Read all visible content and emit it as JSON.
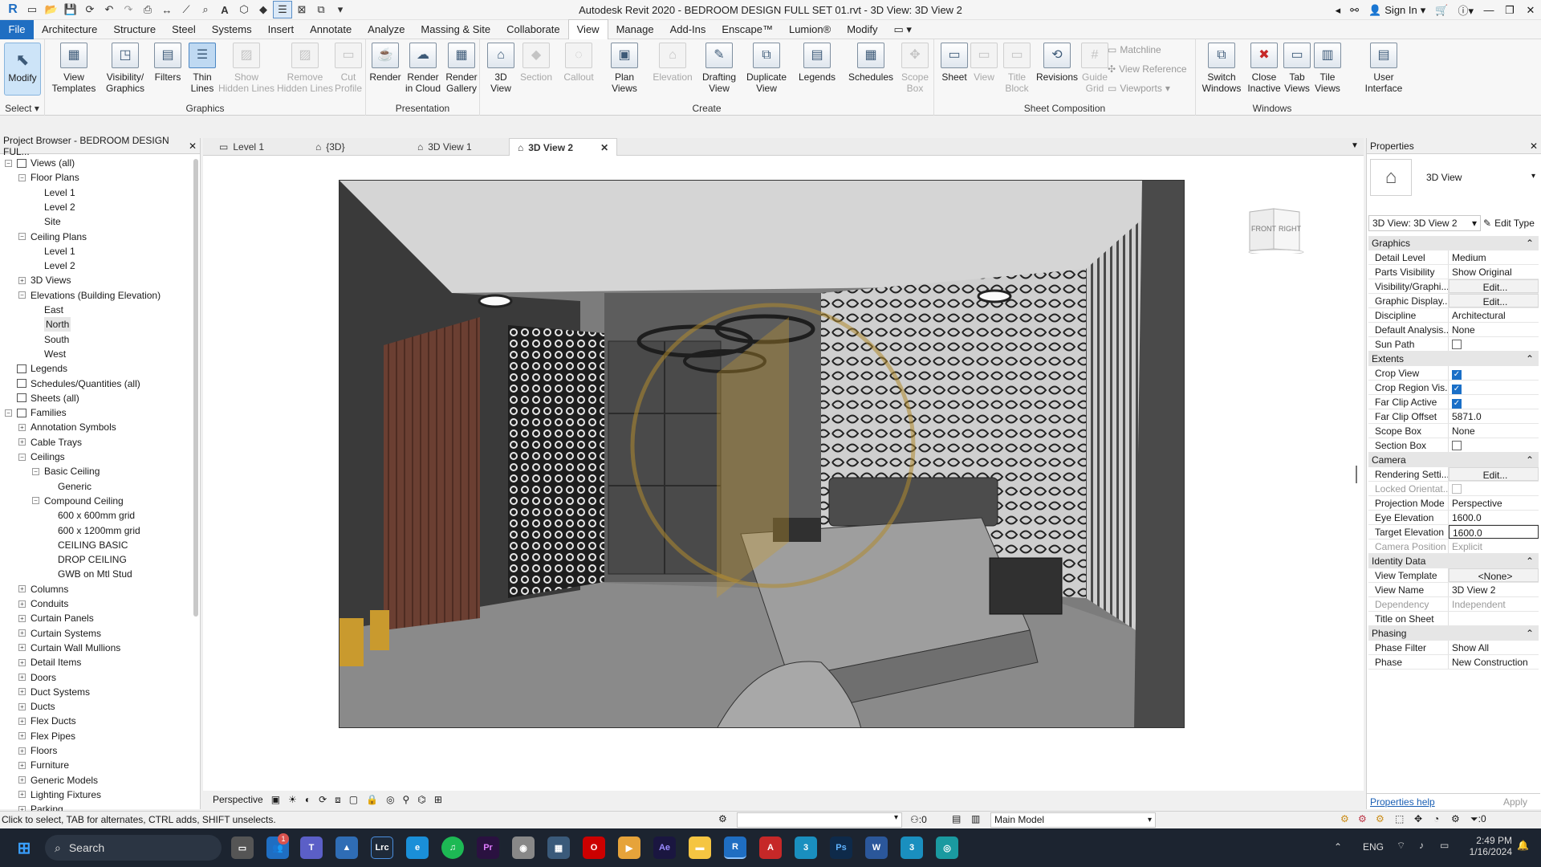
{
  "window": {
    "title": "Autodesk Revit 2020 - BEDROOM DESIGN FULL SET 01.rvt - 3D View: 3D View 2",
    "sign_in": "Sign In"
  },
  "menu": {
    "tabs": [
      "File",
      "Architecture",
      "Structure",
      "Steel",
      "Systems",
      "Insert",
      "Annotate",
      "Analyze",
      "Massing & Site",
      "Collaborate",
      "View",
      "Manage",
      "Add-Ins",
      "Enscape™",
      "Lumion®",
      "Modify"
    ],
    "active": "View"
  },
  "ribbon": {
    "select_label": "Select",
    "graphics_label": "Graphics",
    "presentation_label": "Presentation",
    "create_label": "Create",
    "sheet_comp_label": "Sheet Composition",
    "windows_label": "Windows",
    "buttons": {
      "modify": "Modify",
      "view_templates": "View\nTemplates",
      "visibility": "Visibility/\nGraphics",
      "filters": "Filters",
      "thin_lines": "Thin\nLines",
      "show_hidden": "Show\nHidden Lines",
      "remove_hidden": "Remove\nHidden Lines",
      "cut_profile": "Cut\nProfile",
      "render": "Render",
      "render_cloud": "Render\nin Cloud",
      "render_gallery": "Render\nGallery",
      "view3d": "3D\nView",
      "section": "Section",
      "callout": "Callout",
      "plan_views": "Plan\nViews",
      "elevation": "Elevation",
      "drafting_view": "Drafting\nView",
      "duplicate_view": "Duplicate\nView",
      "legends": "Legends",
      "schedules": "Schedules",
      "scope_box": "Scope\nBox",
      "sheet": "Sheet",
      "view": "View",
      "title_block": "Title\nBlock",
      "revisions": "Revisions",
      "guide_grid": "Guide\nGrid",
      "matchline": "Matchline",
      "view_reference": "View Reference",
      "viewports": "Viewports",
      "switch_windows": "Switch\nWindows",
      "close_inactive": "Close\nInactive",
      "tab_views": "Tab\nViews",
      "tile_views": "Tile\nViews",
      "user_interface": "User\nInterface"
    }
  },
  "project_browser": {
    "title": "Project Browser - BEDROOM DESIGN FUL...",
    "items": [
      {
        "label": "Views (all)",
        "level": 0,
        "tog": "−",
        "icon": "views"
      },
      {
        "label": "Floor Plans",
        "level": 1,
        "tog": "−"
      },
      {
        "label": "Level 1",
        "level": 2
      },
      {
        "label": "Level 2",
        "level": 2
      },
      {
        "label": "Site",
        "level": 2
      },
      {
        "label": "Ceiling Plans",
        "level": 1,
        "tog": "−"
      },
      {
        "label": "Level 1",
        "level": 2
      },
      {
        "label": "Level 2",
        "level": 2
      },
      {
        "label": "3D Views",
        "level": 1,
        "tog": "+"
      },
      {
        "label": "Elevations (Building Elevation)",
        "level": 1,
        "tog": "−"
      },
      {
        "label": "East",
        "level": 2
      },
      {
        "label": "North",
        "level": 2,
        "selected": true
      },
      {
        "label": "South",
        "level": 2
      },
      {
        "label": "West",
        "level": 2
      },
      {
        "label": "Legends",
        "level": 0,
        "icon": "legend"
      },
      {
        "label": "Schedules/Quantities (all)",
        "level": 0,
        "icon": "schedule"
      },
      {
        "label": "Sheets (all)",
        "level": 0,
        "icon": "sheet"
      },
      {
        "label": "Families",
        "level": 0,
        "tog": "−",
        "icon": "family"
      },
      {
        "label": "Annotation Symbols",
        "level": 1,
        "tog": "+"
      },
      {
        "label": "Cable Trays",
        "level": 1,
        "tog": "+"
      },
      {
        "label": "Ceilings",
        "level": 1,
        "tog": "−"
      },
      {
        "label": "Basic Ceiling",
        "level": 2,
        "tog": "−"
      },
      {
        "label": "Generic",
        "level": 3
      },
      {
        "label": "Compound Ceiling",
        "level": 2,
        "tog": "−"
      },
      {
        "label": "600 x 600mm grid",
        "level": 3
      },
      {
        "label": "600 x 1200mm grid",
        "level": 3
      },
      {
        "label": "CEILING BASIC",
        "level": 3
      },
      {
        "label": "DROP CEILING",
        "level": 3
      },
      {
        "label": "GWB on Mtl Stud",
        "level": 3
      },
      {
        "label": "Columns",
        "level": 1,
        "tog": "+"
      },
      {
        "label": "Conduits",
        "level": 1,
        "tog": "+"
      },
      {
        "label": "Curtain Panels",
        "level": 1,
        "tog": "+"
      },
      {
        "label": "Curtain Systems",
        "level": 1,
        "tog": "+"
      },
      {
        "label": "Curtain Wall Mullions",
        "level": 1,
        "tog": "+"
      },
      {
        "label": "Detail Items",
        "level": 1,
        "tog": "+"
      },
      {
        "label": "Doors",
        "level": 1,
        "tog": "+"
      },
      {
        "label": "Duct Systems",
        "level": 1,
        "tog": "+"
      },
      {
        "label": "Ducts",
        "level": 1,
        "tog": "+"
      },
      {
        "label": "Flex Ducts",
        "level": 1,
        "tog": "+"
      },
      {
        "label": "Flex Pipes",
        "level": 1,
        "tog": "+"
      },
      {
        "label": "Floors",
        "level": 1,
        "tog": "+"
      },
      {
        "label": "Furniture",
        "level": 1,
        "tog": "+"
      },
      {
        "label": "Generic Models",
        "level": 1,
        "tog": "+"
      },
      {
        "label": "Lighting Fixtures",
        "level": 1,
        "tog": "+"
      },
      {
        "label": "Parking",
        "level": 1,
        "tog": "+"
      }
    ]
  },
  "view_tabs": [
    {
      "label": "Level 1"
    },
    {
      "label": "{3D}"
    },
    {
      "label": "3D View 1"
    },
    {
      "label": "3D View 2",
      "active": true
    }
  ],
  "viewcube": {
    "front": "FRONT",
    "right": "RIGHT"
  },
  "view_control_bar": {
    "mode": "Perspective"
  },
  "properties": {
    "title": "Properties",
    "type_name": "3D View",
    "selector": "3D View: 3D View 2",
    "edit_type": "Edit Type",
    "help": "Properties help",
    "apply": "Apply",
    "sections": [
      {
        "name": "Graphics",
        "rows": [
          {
            "k": "Detail Level",
            "v": "Medium"
          },
          {
            "k": "Parts Visibility",
            "v": "Show Original"
          },
          {
            "k": "Visibility/Graphi...",
            "v": "Edit...",
            "btn": true
          },
          {
            "k": "Graphic Display...",
            "v": "Edit...",
            "btn": true
          },
          {
            "k": "Discipline",
            "v": "Architectural"
          },
          {
            "k": "Default Analysis...",
            "v": "None"
          },
          {
            "k": "Sun Path",
            "cb": "off"
          }
        ]
      },
      {
        "name": "Extents",
        "rows": [
          {
            "k": "Crop View",
            "cb": "on"
          },
          {
            "k": "Crop Region Vis...",
            "cb": "on"
          },
          {
            "k": "Far Clip Active",
            "cb": "on"
          },
          {
            "k": "Far Clip Offset",
            "v": "5871.0"
          },
          {
            "k": "Scope Box",
            "v": "None"
          },
          {
            "k": "Section Box",
            "cb": "off"
          }
        ]
      },
      {
        "name": "Camera",
        "rows": [
          {
            "k": "Rendering Setti...",
            "v": "Edit...",
            "btn": true
          },
          {
            "k": "Locked Orientat...",
            "cb": "dis",
            "gray": true
          },
          {
            "k": "Projection Mode",
            "v": "Perspective"
          },
          {
            "k": "Eye Elevation",
            "v": "1600.0"
          },
          {
            "k": "Target Elevation",
            "v": "1600.0",
            "edit": true
          },
          {
            "k": "Camera Position",
            "v": "Explicit",
            "gray": true
          }
        ]
      },
      {
        "name": "Identity Data",
        "rows": [
          {
            "k": "View Template",
            "v": "<None>",
            "btn": true
          },
          {
            "k": "View Name",
            "v": "3D View 2"
          },
          {
            "k": "Dependency",
            "v": "Independent",
            "gray": true
          },
          {
            "k": "Title on Sheet",
            "v": ""
          }
        ]
      },
      {
        "name": "Phasing",
        "rows": [
          {
            "k": "Phase Filter",
            "v": "Show All"
          },
          {
            "k": "Phase",
            "v": "New Construction"
          }
        ]
      }
    ]
  },
  "status": {
    "hint": "Click to select, TAB for alternates, CTRL adds, SHIFT unselects.",
    "zero": ":0",
    "model": "Main Model",
    "filter_count": ":0"
  },
  "taskbar": {
    "search": "Search",
    "lang": "ENG",
    "time": "2:49 PM",
    "date": "1/16/2024",
    "badge": "1"
  }
}
